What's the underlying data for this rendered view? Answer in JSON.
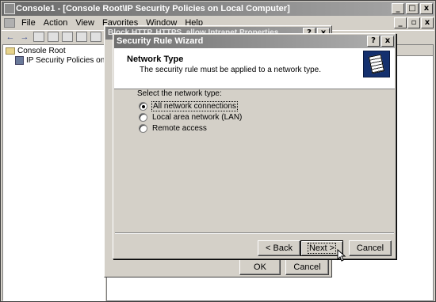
{
  "mmc": {
    "title": "Console1 - [Console Root\\IP Security Policies on Local Computer]",
    "menu": [
      "File",
      "Action",
      "View",
      "Favorites",
      "Window",
      "Help"
    ],
    "caption_min": "_",
    "caption_max": "□",
    "caption_close": "x",
    "mdi_min": "_",
    "mdi_restore": "▫",
    "mdi_close": "x",
    "tree": {
      "root": "Console Root",
      "child": "IP Security Policies on Local C"
    }
  },
  "props_dialog": {
    "title": "Block HTTP, HTTPS, allow Intranet Properties",
    "help": "?",
    "close": "x",
    "ok_label": "OK",
    "cancel_label": "Cancel"
  },
  "wizard": {
    "title": "Security Rule Wizard",
    "help": "?",
    "close": "x",
    "header_title": "Network Type",
    "header_subtitle": "The security rule must be applied to a network type.",
    "prompt": "Select the network type:",
    "options": [
      {
        "label": "All network connections",
        "selected": true
      },
      {
        "label": "Local area network (LAN)",
        "selected": false
      },
      {
        "label": "Remote access",
        "selected": false
      }
    ],
    "back_label": "< Back",
    "next_label": "Next >",
    "cancel_label": "Cancel"
  }
}
